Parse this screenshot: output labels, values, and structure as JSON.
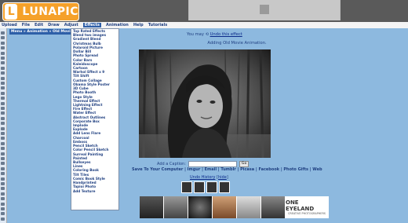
{
  "app": {
    "logo_text": "LUNAPIC",
    "logo_mark": "L"
  },
  "menu": [
    "Upload",
    "File",
    "Edit",
    "Draw",
    "Adjust",
    "Effects",
    "Animation",
    "Help",
    "Tutorials"
  ],
  "menu_active": "Effects",
  "breadcrumb": "Menu » Animation » Old Movie Effect",
  "dropdown_items": [
    "Top Rated Effects",
    "Blend two images",
    "Gradient Blend",
    "Christmas Bulb",
    "Polaroid Picture",
    "Dollar Bill",
    "Photo Spread",
    "Color Bars",
    "Kaleidoscope",
    "Cartoon",
    "Warhol Effect x 9",
    "Tilt Shift",
    "Custom Collage",
    "Obama Style Poster",
    "3D Cube",
    "Photo Booth",
    "Lego Style",
    "Thermal Effect",
    "Lightning Effect",
    "Fire Effect",
    "Water Effect",
    "Abstract Outlines",
    "Corporate Box",
    "Implode",
    "Explode",
    "Add Lens Flare",
    "Charcoal",
    "Emboss",
    "Pencil Sketch",
    "Color Pencil Sketch",
    "Surreal Painting",
    "Painted",
    "Bullseyes",
    "Lines",
    "Coloring Book",
    "Tilt Tiles",
    "Comic Book Style",
    "Handprinted",
    "Tapioi Photo",
    "Add Texture"
  ],
  "status": {
    "prefix": "You may",
    "link": "Undo this effect"
  },
  "message": "Adding Old Movie Animation.",
  "caption": {
    "label": "Add a Caption:",
    "go": "Go"
  },
  "save_line": "Save To Your Computer | Imgur | Email | Tumblr | Picasa | Facebook | Photo Gifts | Web",
  "undo": {
    "link": "Undo History",
    "hide": "hide"
  },
  "eyeland": {
    "line1": "ONE EYELAND",
    "line2": "CREATIVE PHOTOGRAPHERS"
  },
  "colors": {
    "background": "#8db9df",
    "menu_active": "#2e5fa8",
    "logo": "#f5a12a"
  }
}
